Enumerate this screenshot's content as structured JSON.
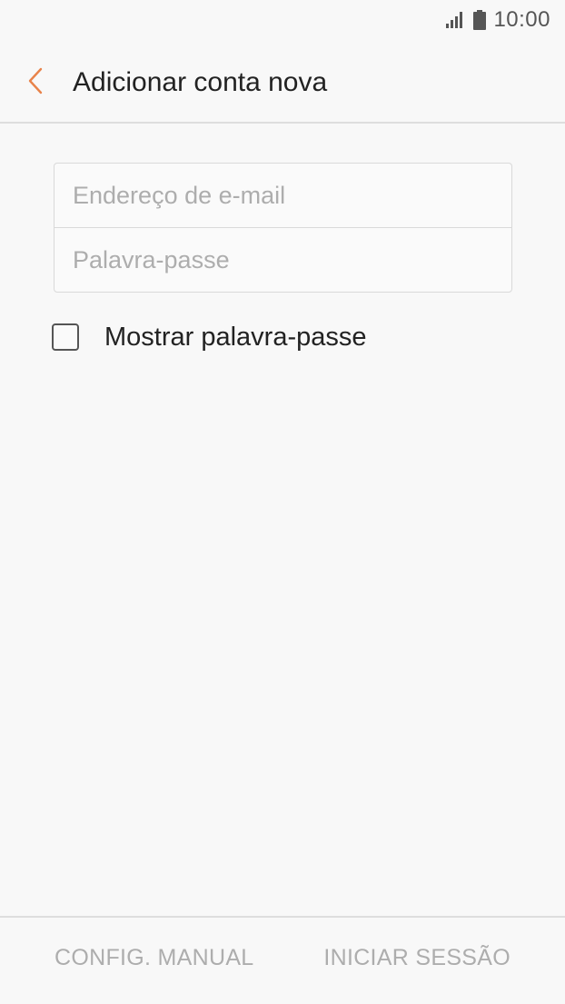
{
  "status_bar": {
    "time": "10:00",
    "icons": [
      "signal-icon",
      "battery-icon"
    ],
    "icon_color": "#555555"
  },
  "header": {
    "title": "Adicionar conta nova",
    "back_icon": "chevron-left-icon",
    "accent_color": "#e8834a"
  },
  "form": {
    "email_placeholder": "Endereço de e-mail",
    "email_value": "",
    "password_placeholder": "Palavra-passe",
    "password_value": "",
    "show_password_label": "Mostrar palavra-passe",
    "show_password_checked": false
  },
  "footer": {
    "manual_config_label": "CONFIG. MANUAL",
    "sign_in_label": "INICIAR SESSÃO",
    "disabled_text_color": "#adadad"
  }
}
